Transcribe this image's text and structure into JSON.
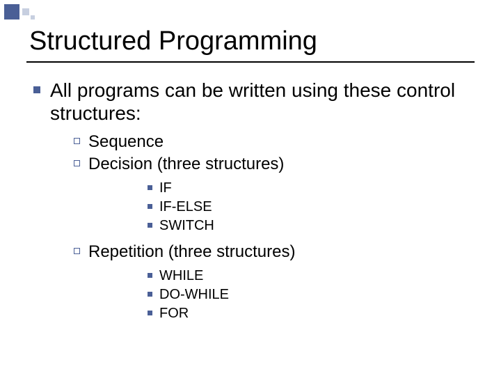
{
  "title": "Structured Programming",
  "main": {
    "text": "All programs can be written using these control structures:",
    "items": [
      {
        "label": "Sequence"
      },
      {
        "label": "Decision (three structures)",
        "sub": [
          {
            "label": "IF"
          },
          {
            "label": "IF-ELSE"
          },
          {
            "label": "SWITCH"
          }
        ]
      },
      {
        "label": "Repetition (three structures)",
        "sub": [
          {
            "label": "WHILE"
          },
          {
            "label": "DO-WHILE"
          },
          {
            "label": "FOR"
          }
        ]
      }
    ]
  }
}
